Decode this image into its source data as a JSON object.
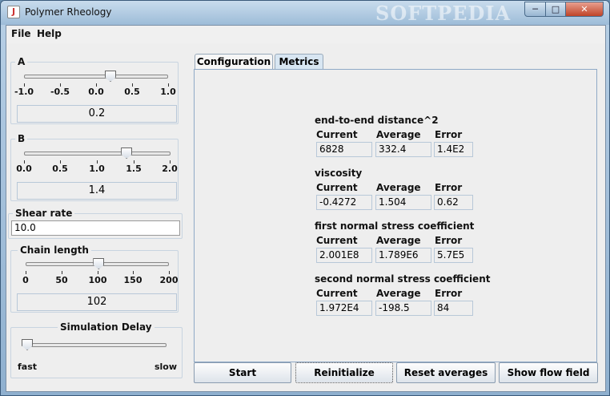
{
  "window": {
    "title": "Polymer Rheology",
    "watermark": "SOFTPEDIA",
    "min_glyph": "─",
    "max_glyph": "□",
    "close_glyph": "✕",
    "app_icon_glyph": "J"
  },
  "menu": {
    "file": "File",
    "help": "Help"
  },
  "left": {
    "a": {
      "label": "A",
      "ticks": [
        "-1.0",
        "-0.5",
        "0.0",
        "0.5",
        "1.0"
      ],
      "value": "0.2",
      "fraction": 0.6
    },
    "b": {
      "label": "B",
      "ticks": [
        "0.0",
        "0.5",
        "1.0",
        "1.5",
        "2.0"
      ],
      "value": "1.4",
      "fraction": 0.7
    },
    "shear": {
      "label": "Shear rate",
      "value": "10.0"
    },
    "chain": {
      "label": "Chain length",
      "ticks": [
        "0",
        "50",
        "100",
        "150",
        "200"
      ],
      "value": "102",
      "fraction": 0.51
    },
    "delay": {
      "label": "Simulation Delay",
      "fast": "fast",
      "slow": "slow",
      "fraction": 0.0
    }
  },
  "tabs": {
    "configuration": "Configuration",
    "metrics": "Metrics"
  },
  "columns": {
    "current": "Current",
    "average": "Average",
    "error": "Error"
  },
  "metrics": {
    "e2e": {
      "title": "end-to-end distance^2",
      "current": "6828",
      "average": "332.4",
      "error": "1.4E2"
    },
    "visc": {
      "title": "viscosity",
      "current": "-0.4272",
      "average": "1.504",
      "error": "0.62"
    },
    "first": {
      "title": "first normal stress coefficient",
      "current": "2.001E8",
      "average": "1.789E6",
      "error": "5.7E5"
    },
    "second": {
      "title": "second normal stress coefficient",
      "current": "1.972E4",
      "average": "-198.5",
      "error": "84"
    }
  },
  "buttons": {
    "start": "Start",
    "reinitialize": "Reinitialize",
    "reset": "Reset averages",
    "flow": "Show flow field"
  }
}
